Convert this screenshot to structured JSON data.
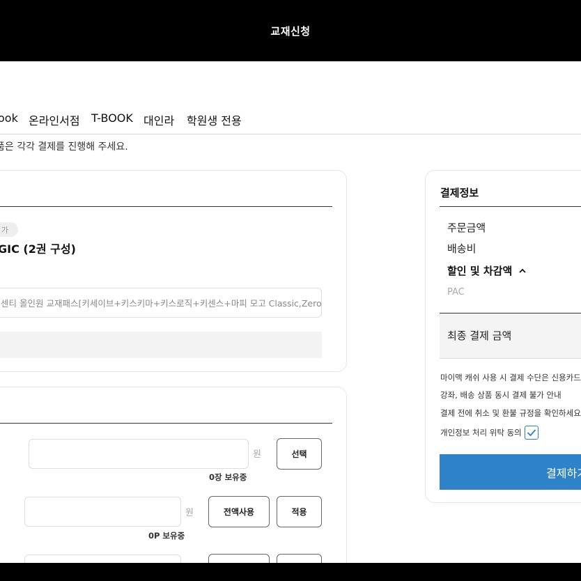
{
  "header": {
    "title": "교재신청"
  },
  "tabs": [
    {
      "label": "ook"
    },
    {
      "label": "온라인서점"
    },
    {
      "label": "T-BOOK"
    },
    {
      "label": "대인라"
    },
    {
      "label": "학원생 전용"
    }
  ],
  "notice": "품은 각각 결제를 진행해 주세요.",
  "product": {
    "badge": "가",
    "title": "GIC (2권 구성)",
    "description": "센티 올인원 교재패스[키세이브+키스키마+키스로직+키센스+마피 모고 Classic,Zero,One"
  },
  "discounts": {
    "coupon": {
      "unit": "원",
      "select_label": "선택",
      "holding": "0장 보유중"
    },
    "points": {
      "unit": "원",
      "use_all_label": "전액사용",
      "apply_label": "적용",
      "holding": "0P 보유중"
    }
  },
  "payment": {
    "title": "결제정보",
    "order_amount_label": "주문금액",
    "shipping_label": "배송비",
    "discount_label": "할인 및 차감액",
    "discount_sub": "PAC",
    "final_label": "최종 결제 금액",
    "notes": [
      "마이맥 캐쉬 사용 시 결제 수단은 신용카드만",
      "강좌, 배송 상품 동시 결제 불가 안내",
      "결제 전에 취소 및 환불 규정을 확인하세요"
    ],
    "consent_label": "개인정보 처리 위탁 동의",
    "consent_checked": true,
    "pay_button": "결제하기",
    "accent_color": "#2d82c8"
  }
}
